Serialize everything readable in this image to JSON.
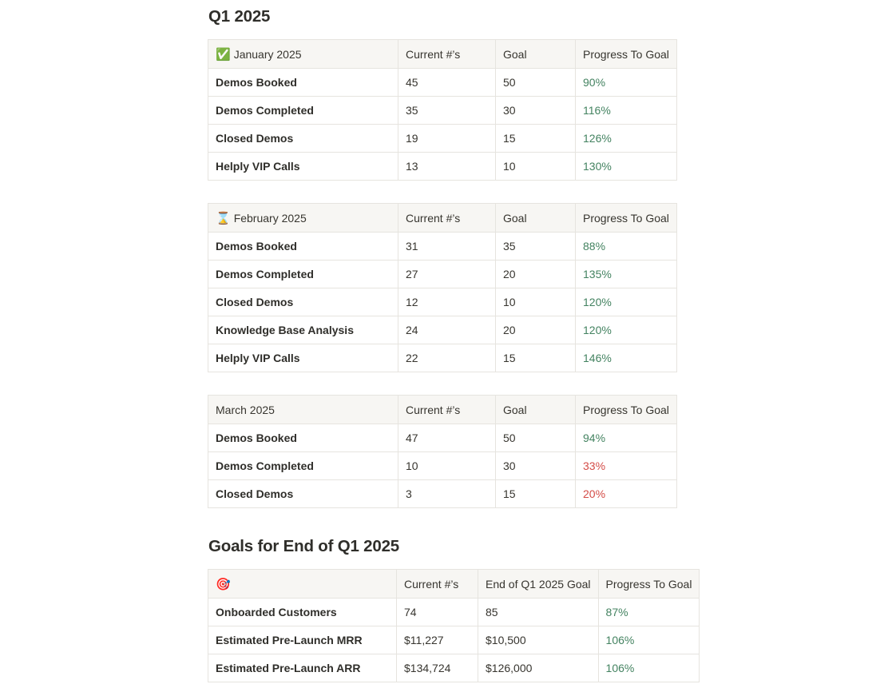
{
  "q1_title": "Q1 2025",
  "goals_title": "Goals for End of Q1 2025",
  "jan": {
    "icon": "✅",
    "header": [
      "January 2025",
      "Current #’s",
      "Goal",
      "Progress To Goal"
    ],
    "rows": [
      [
        "Demos Booked",
        "45",
        "50",
        "90%"
      ],
      [
        "Demos Completed",
        "35",
        "30",
        "116%"
      ],
      [
        "Closed Demos",
        "19",
        "15",
        "126%"
      ],
      [
        "Helply VIP Calls",
        "13",
        "10",
        "130%"
      ]
    ]
  },
  "feb": {
    "icon": "⌛",
    "header": [
      "February 2025",
      "Current #’s",
      "Goal",
      "Progress To Goal"
    ],
    "rows": [
      [
        "Demos Booked",
        "31",
        "35",
        "88%"
      ],
      [
        "Demos Completed",
        "27",
        "20",
        "135%"
      ],
      [
        "Closed Demos",
        "12",
        "10",
        "120%"
      ],
      [
        "Knowledge Base Analysis",
        "24",
        "20",
        "120%"
      ],
      [
        "Helply VIP Calls",
        "22",
        "15",
        "146%"
      ]
    ]
  },
  "mar": {
    "header": [
      "March 2025",
      "Current #’s",
      "Goal",
      "Progress To Goal"
    ],
    "rows": [
      [
        "Demos Booked",
        "47",
        "50",
        "94%"
      ],
      [
        "Demos Completed",
        "10",
        "30",
        "33%"
      ],
      [
        "Closed Demos",
        "3",
        "15",
        "20%"
      ]
    ]
  },
  "goals": {
    "icon": "🎯",
    "header": [
      "",
      "Current #’s",
      "End of Q1 2025 Goal",
      "Progress To Goal"
    ],
    "rows": [
      [
        "Onboarded Customers",
        "74",
        "85",
        "87%"
      ],
      [
        "Estimated Pre-Launch MRR",
        "$11,227",
        "$10,500",
        "106%"
      ],
      [
        "Estimated Pre-Launch ARR",
        "$134,724",
        "$126,000",
        "106%"
      ]
    ]
  },
  "colors": {
    "progress_good": "#448361",
    "progress_bad": "#d44c47"
  }
}
